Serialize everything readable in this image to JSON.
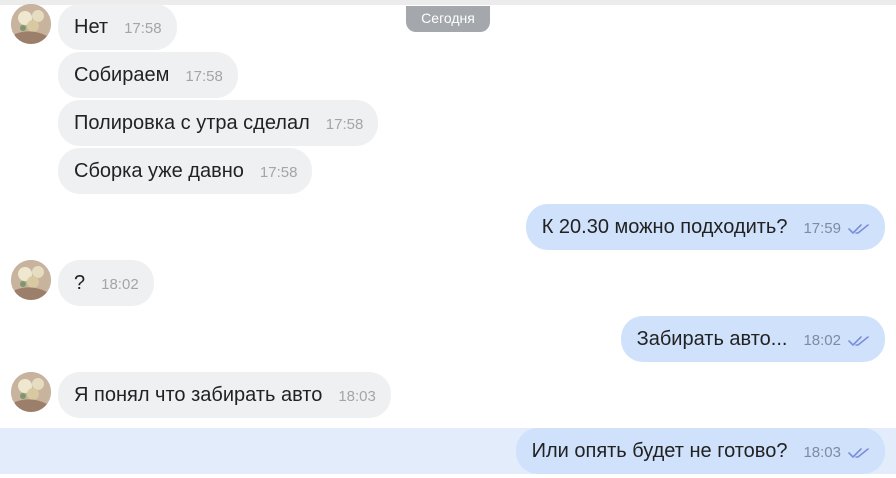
{
  "date_separator": "Сегодня",
  "messages": [
    {
      "text": "Нет",
      "time": "17:58"
    },
    {
      "text": "Собираем",
      "time": "17:58"
    },
    {
      "text": "Полировка с утра сделал",
      "time": "17:58"
    },
    {
      "text": "Сборка уже давно",
      "time": "17:58"
    },
    {
      "text": "К 20.30 можно подходить?",
      "time": "17:59"
    },
    {
      "text": "?",
      "time": "18:02"
    },
    {
      "text": "Забирать авто...",
      "time": "18:02"
    },
    {
      "text": "Я понял что забирать авто",
      "time": "18:03"
    },
    {
      "text": "Или опять будет не готово?",
      "time": "18:03"
    }
  ],
  "colors": {
    "incoming_bubble": "#eff0f1",
    "outgoing_bubble": "#cfe1fb",
    "read_check": "#7b8fd9",
    "date_pill": "#a4a7ab",
    "highlight_row": "#e2ecfb"
  },
  "icons": {
    "read": "double-check-icon",
    "avatar": "contact-avatar"
  }
}
